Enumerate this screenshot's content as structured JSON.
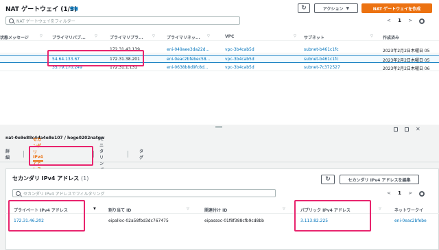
{
  "header": {
    "title": "NAT ゲートウェイ (1/3)",
    "info": "情報",
    "actions_label": "アクション",
    "create_label": "NAT ゲートウェイを作成",
    "refresh_icon": "refresh-icon"
  },
  "search": {
    "placeholder": "NAT ゲートウェイをフィルター"
  },
  "pager": {
    "prev": "<",
    "page": "1",
    "next": ">"
  },
  "table": {
    "columns": [
      "状態メッセージ",
      "プライマリパブ...",
      "プライマリプラ...",
      "プライマリネッ...",
      "VPC",
      "サブネット",
      "作成済み"
    ],
    "rows": [
      {
        "public_ip": "",
        "private_ip": "172.31.43.139",
        "eni": "eni-049aee3da22d...",
        "vpc": "vpc-3b4cab5d",
        "subnet": "subnet-b461c1fc",
        "created": "2023年2月2日木曜日 05"
      },
      {
        "public_ip": "54.64.133.67",
        "private_ip": "172.31.38.201",
        "eni": "eni-0eac2bfebec58...",
        "vpc": "vpc-3b4cab5d",
        "subnet": "subnet-b461c1fc",
        "created": "2023年2月2日木曜日 05"
      },
      {
        "public_ip": "35.79.170.249",
        "private_ip": "172.31.1.131",
        "eni": "eni-0638b8d9fc8d...",
        "vpc": "vpc-3b4cab5d",
        "subnet": "subnet-7c372527",
        "created": "2023年2月2日木曜日 06"
      }
    ]
  },
  "detail": {
    "resource_id": "nat-0e9e88c4da4e8e107 / hoge0202natgw",
    "tabs": [
      "詳細",
      "セカンダリ IPv4 アドレス",
      "モニタリング",
      "タグ"
    ],
    "section_title": "セカンダリ IPv4 アドレス",
    "section_count": "(1)",
    "edit_label": "セカンダリ IPv4 アドレスを編集",
    "search_placeholder": "セカンダリ IPv4 アドレスでフィルタリング",
    "pager": {
      "prev": "<",
      "page": "1",
      "next": ">"
    },
    "columns": [
      "プライベート IPv4 アドレス",
      "割り当て ID",
      "関連付け ID",
      "パブリック IPv4 アドレス",
      "ネットワークイ"
    ],
    "row": {
      "private_ip": "172.31.46.202",
      "alloc_id": "eipalloc-02a58fbd3dc767475",
      "assoc_id": "eipassoc-01f8f388cfb9cd8bb",
      "public_ip": "3.113.82.225",
      "eni": "eni-0eac2bfebe"
    }
  }
}
